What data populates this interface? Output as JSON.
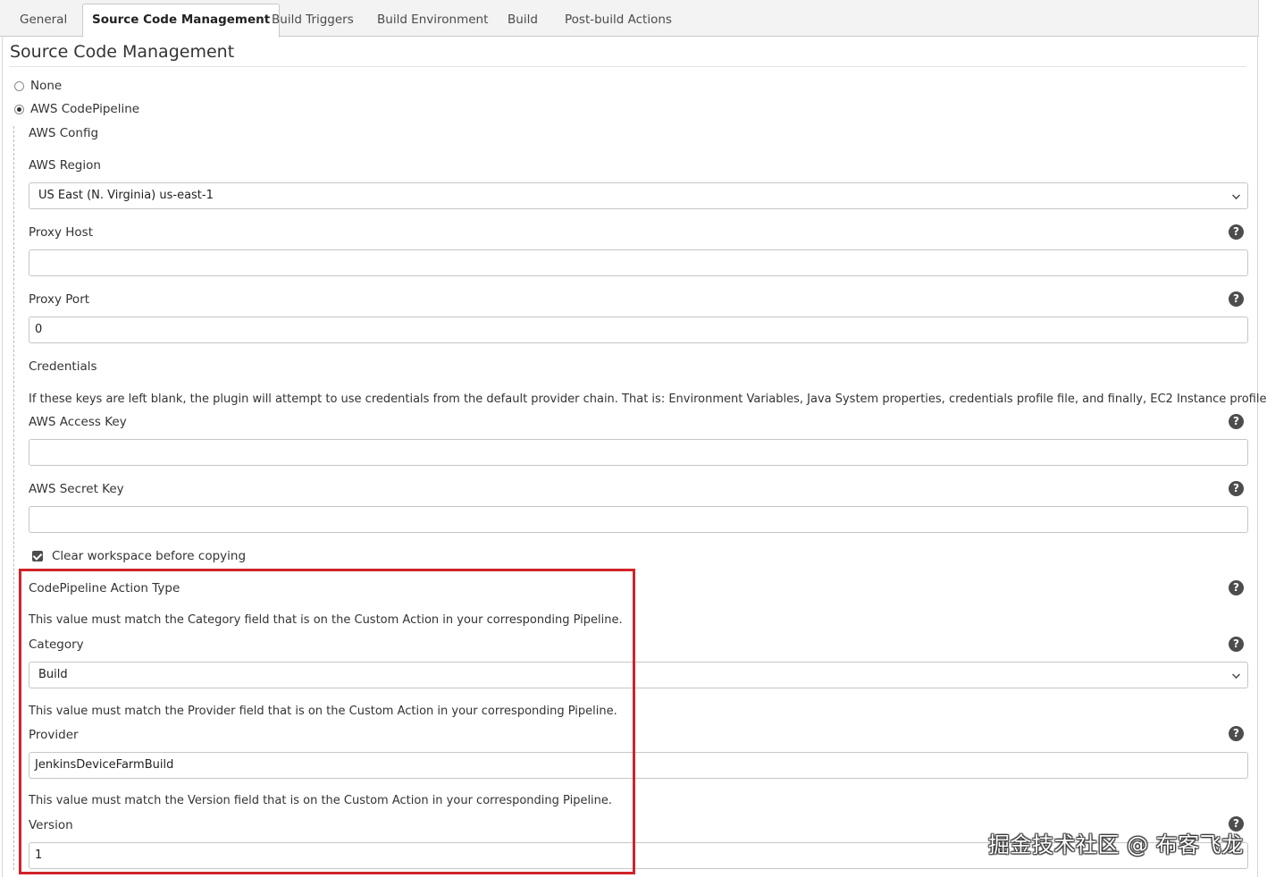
{
  "tabs": [
    "General",
    "Source Code Management",
    "Build Triggers",
    "Build Environment",
    "Build",
    "Post-build Actions"
  ],
  "active_tab": "Source Code Management",
  "section_title": "Source Code Management",
  "scm_options": {
    "none_label": "None",
    "aws_label": "AWS CodePipeline",
    "selected": "AWS CodePipeline"
  },
  "aws_config_label": "AWS Config",
  "region": {
    "label": "AWS Region",
    "value": "US East (N. Virginia) us-east-1"
  },
  "proxy_host": {
    "label": "Proxy Host",
    "value": ""
  },
  "proxy_port": {
    "label": "Proxy Port",
    "value": "0"
  },
  "credentials": {
    "label": "Credentials",
    "note": "If these keys are left blank, the plugin will attempt to use credentials from the default provider chain. That is: Environment Variables, Java System properties, credentials profile file, and finally, EC2 Instance profile.",
    "access_key_label": "AWS Access Key",
    "access_key_value": "",
    "secret_key_label": "AWS Secret Key",
    "secret_key_value": ""
  },
  "clear_workspace": {
    "label": "Clear workspace before copying",
    "checked": true
  },
  "action_type": {
    "label": "CodePipeline Action Type",
    "category_note": "This value must match the Category field that is on the Custom Action in your corresponding Pipeline.",
    "category_label": "Category",
    "category_value": "Build",
    "provider_note": "This value must match the Provider field that is on the Custom Action in your corresponding Pipeline.",
    "provider_label": "Provider",
    "provider_value": "JenkinsDeviceFarmBuild",
    "version_note": "This value must match the Version field that is on the Custom Action in your corresponding Pipeline.",
    "version_label": "Version",
    "version_value": "1"
  },
  "help_glyph": "?",
  "watermark": "掘金技术社区 @ 布客飞龙",
  "colors": {
    "highlight": "#d1232a",
    "help_icon": "#4d4d4d"
  }
}
